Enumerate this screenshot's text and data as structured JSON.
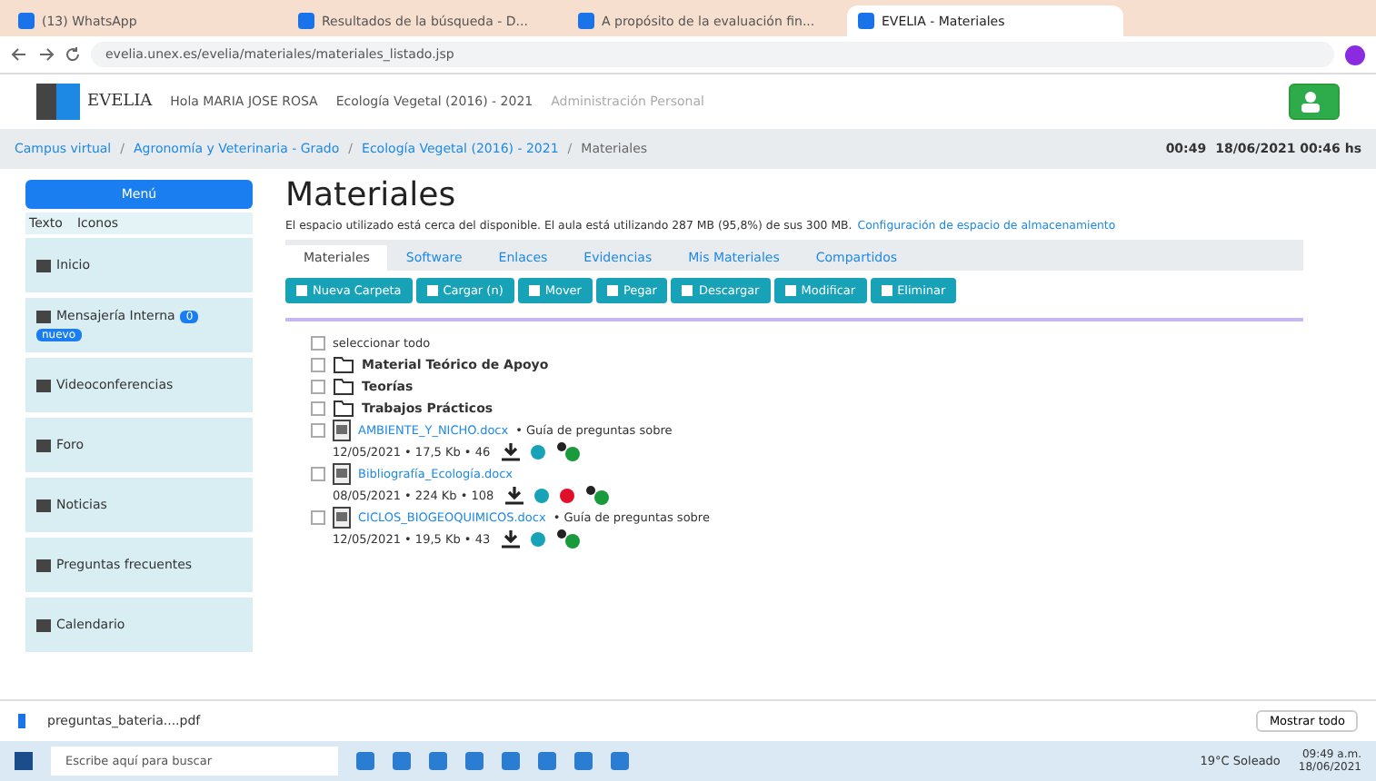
{
  "browser": {
    "tabs": [
      {
        "title": "(13) WhatsApp",
        "selected": false
      },
      {
        "title": "Resultados de la búsqueda - D...",
        "selected": false
      },
      {
        "title": "A propósito de la evaluación fin...",
        "selected": false
      },
      {
        "title": "EVELIA - Materiales",
        "selected": true
      }
    ],
    "url": "evelia.unex.es/evelia/materiales/materiales_listado.jsp"
  },
  "app_header": {
    "logo": "EVELIA",
    "user": "Hola MARIA JOSE ROSA",
    "course": "Ecología Vegetal (2016) - 2021",
    "extra": "Administración Personal"
  },
  "breadcrumb": {
    "separator": "/",
    "items": [
      "Campus virtual",
      "Agronomía y Veterinaria - Grado",
      "Ecología Vegetal (2016) - 2021",
      "Materiales"
    ],
    "clock": "00:49",
    "date": "18/06/2021 00:46 hs"
  },
  "sidebar": {
    "menu_button": "Menú",
    "view_options": [
      "Texto",
      "Iconos"
    ],
    "items": [
      {
        "label": "Inicio"
      },
      {
        "label": "Mensajería Interna",
        "badges": [
          "0",
          "nuevo"
        ]
      },
      {
        "label": "Videoconferencias"
      },
      {
        "label": "Foro"
      },
      {
        "label": "Noticias"
      },
      {
        "label": "Preguntas frecuentes"
      },
      {
        "label": "Calendario"
      }
    ]
  },
  "main": {
    "title": "Materiales",
    "notice": {
      "text": "El espacio utilizado está cerca del disponible. El aula está utilizando 287 MB (95,8%) de sus 300 MB.",
      "link": "Configuración de espacio de almacenamiento"
    },
    "tabs": [
      {
        "label": "Materiales",
        "selected": true
      },
      {
        "label": "Software",
        "selected": false
      },
      {
        "label": "Enlaces",
        "selected": false
      },
      {
        "label": "Evidencias",
        "selected": false
      },
      {
        "label": "Mis Materiales",
        "selected": false
      },
      {
        "label": "Compartidos",
        "selected": false
      }
    ],
    "toolbar": [
      "Nueva Carpeta",
      "Cargar (n)",
      "Mover",
      "Pegar",
      "Descargar",
      "Modificar",
      "Eliminar"
    ],
    "select_all": {
      "label": "seleccionar todo",
      "checked": false
    },
    "folders": [
      {
        "name": "Material Teórico de Apoyo",
        "checked": false
      },
      {
        "name": "Teorías",
        "checked": false
      },
      {
        "name": "Trabajos Prácticos",
        "checked": false
      }
    ],
    "files": [
      {
        "name": "AMBIENTE_Y_NICHO.docx",
        "description": "• Guía de preguntas sobre",
        "meta": "12/05/2021 • 17,5 Kb • 46",
        "checked": false,
        "alert": false
      },
      {
        "name": "Bibliografía_Ecología.docx",
        "meta": "08/05/2021 • 224 Kb • 108",
        "checked": false,
        "alert": true
      },
      {
        "name": "CICLOS_BIOGEOQUIMICOS.docx",
        "description": "• Guía de preguntas sobre",
        "meta": "12/05/2021 • 19,5 Kb • 43",
        "checked": false,
        "alert": false
      }
    ]
  },
  "download_bar": {
    "file": "preguntas_bateria....pdf",
    "show_all": "Mostrar todo"
  },
  "taskbar": {
    "search_placeholder": "Escribe aquí para buscar",
    "weather": "19°C Soleado",
    "time": "09:49 a.m.",
    "date": "18/06/2021"
  }
}
